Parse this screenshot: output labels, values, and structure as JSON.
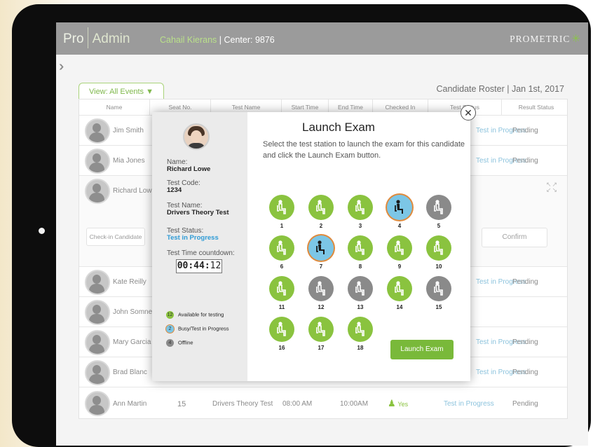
{
  "header": {
    "app_name_pro": "Pro",
    "app_name_admin": "Admin",
    "user_name": "Cahail Kierans",
    "center": " | Center: 9876",
    "brand": "PROMETRIC"
  },
  "toolbar": {
    "view_label": "View:  All Events  ▼",
    "roster_title": "Candidate Roster | Jan 1st, 2017"
  },
  "table": {
    "columns": [
      "Name",
      "Seat No.",
      "Test Name",
      "Start Time",
      "End Time",
      "Checked In",
      "Test Status",
      "Result Status"
    ],
    "rows": [
      {
        "name": "Jim Smith",
        "status": "Test in Progress",
        "result": "Pending"
      },
      {
        "name": "Mia Jones",
        "status": "Test in Progress",
        "result": "Pending"
      },
      {
        "name": "Richard Lowe",
        "checkin_btn": "Check-in Candidate",
        "confirm_btn": "Confirm"
      },
      {
        "name": "Kate Reilly",
        "status": "Test in Progress",
        "result": "Pending"
      },
      {
        "name": "John Somner"
      },
      {
        "name": "Mary Garcia",
        "status": "Test in Progress",
        "result": "Pending"
      },
      {
        "name": "Brad Blanc",
        "status": "Test in Progress",
        "result": "Pending"
      },
      {
        "name": "Ann Martin",
        "seat": "15",
        "test": "Drivers Theory Test",
        "start": "08:00 AM",
        "end": "10:00AM",
        "checked": "Yes",
        "status": "Test in Progress",
        "result": "Pending"
      }
    ]
  },
  "modal": {
    "title": "Launch Exam",
    "description": "Select the test station to launch the exam for this candidate and click the Launch Exam button.",
    "name_label": "Name:",
    "name_value": "Richard Lowe",
    "code_label": "Test Code:",
    "code_value": "1234",
    "testname_label": "Test Name:",
    "testname_value": "Drivers Theory Test",
    "status_label": "Test Status:",
    "status_value": "Test in Progress",
    "countdown_label": "Test Time countdown:",
    "countdown_main": "00:44:",
    "countdown_sec": "12",
    "legend": [
      {
        "count": "12",
        "label": "Available for testing",
        "color": "#8ac33f"
      },
      {
        "count": "2",
        "label": "Busy/Test in Progress",
        "color": "#7cc6e6"
      },
      {
        "count": "4",
        "label": "Offline",
        "color": "#8a8a8a"
      }
    ],
    "launch_label": "Launch Exam",
    "stations": [
      {
        "num": "1",
        "state": "available"
      },
      {
        "num": "2",
        "state": "available"
      },
      {
        "num": "3",
        "state": "available"
      },
      {
        "num": "4",
        "state": "busy"
      },
      {
        "num": "5",
        "state": "offline"
      },
      {
        "num": "6",
        "state": "available"
      },
      {
        "num": "7",
        "state": "busy"
      },
      {
        "num": "8",
        "state": "available"
      },
      {
        "num": "9",
        "state": "available"
      },
      {
        "num": "10",
        "state": "available"
      },
      {
        "num": "11",
        "state": "available"
      },
      {
        "num": "12",
        "state": "offline"
      },
      {
        "num": "13",
        "state": "offline"
      },
      {
        "num": "14",
        "state": "available"
      },
      {
        "num": "15",
        "state": "offline"
      },
      {
        "num": "16",
        "state": "available"
      },
      {
        "num": "17",
        "state": "available"
      },
      {
        "num": "18",
        "state": "available"
      }
    ]
  }
}
